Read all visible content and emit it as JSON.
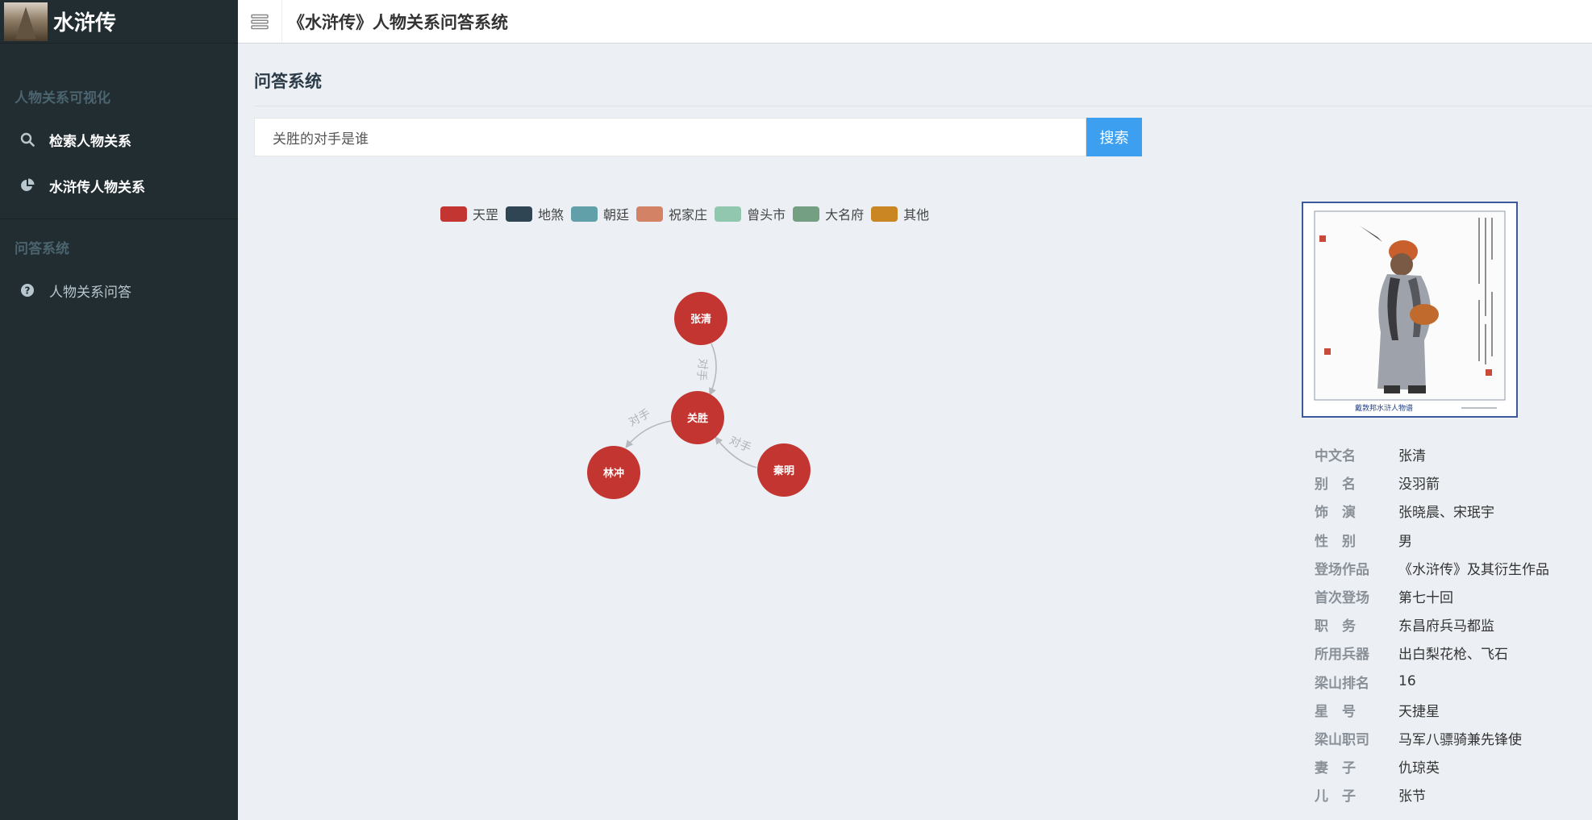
{
  "sidebar": {
    "logo_text": "水浒传",
    "sections": [
      {
        "header": "人物关系可视化",
        "items": [
          {
            "label": "检索人物关系",
            "icon": "search-icon"
          },
          {
            "label": "水浒传人物关系",
            "icon": "pie-chart-icon"
          }
        ]
      },
      {
        "header": "问答系统",
        "items": [
          {
            "label": "人物关系问答",
            "icon": "question-circle-icon"
          }
        ]
      }
    ]
  },
  "topbar": {
    "toggle_icon": "menu-toggle-icon",
    "title": "《水浒传》人物关系问答系统"
  },
  "main": {
    "page_title": "问答系统",
    "search": {
      "value": "关胜的对手是谁",
      "placeholder": "",
      "button_label": "搜索"
    }
  },
  "legend": [
    {
      "label": "天罡",
      "color": "#c23531"
    },
    {
      "label": "地煞",
      "color": "#2f4554"
    },
    {
      "label": "朝廷",
      "color": "#61a0a8"
    },
    {
      "label": "祝家庄",
      "color": "#d48265"
    },
    {
      "label": "曾头市",
      "color": "#91c7ae"
    },
    {
      "label": "大名府",
      "color": "#749f83"
    },
    {
      "label": "其他",
      "color": "#ca8622"
    }
  ],
  "graph": {
    "nodes": [
      "张清",
      "关胜",
      "林冲",
      "秦明"
    ],
    "edges": [
      {
        "source": "张清",
        "target": "关胜",
        "label": "对手"
      },
      {
        "source": "关胜",
        "target": "林冲",
        "label": "对手"
      },
      {
        "source": "秦明",
        "target": "关胜",
        "label": "对手"
      }
    ],
    "node_color": "#c23531"
  },
  "profile": {
    "portrait_caption": "戴敦邦水浒人物谱",
    "fields": [
      {
        "key": "中文名",
        "value": "张清"
      },
      {
        "key": "别　名",
        "value": "没羽箭"
      },
      {
        "key": "饰　演",
        "value": "张晓晨、宋珉宇"
      },
      {
        "key": "性　别",
        "value": "男"
      },
      {
        "key": "登场作品",
        "value": "《水浒传》及其衍生作品"
      },
      {
        "key": "首次登场",
        "value": "第七十回"
      },
      {
        "key": "职　务",
        "value": "东昌府兵马都监"
      },
      {
        "key": "所用兵器",
        "value": "出白梨花枪、飞石"
      },
      {
        "key": "梁山排名",
        "value": "16"
      },
      {
        "key": "星　号",
        "value": "天捷星"
      },
      {
        "key": "梁山职司",
        "value": "马军八骠骑兼先锋使"
      },
      {
        "key": "妻　子",
        "value": "仇琼英"
      },
      {
        "key": "儿　子",
        "value": "张节"
      }
    ]
  }
}
